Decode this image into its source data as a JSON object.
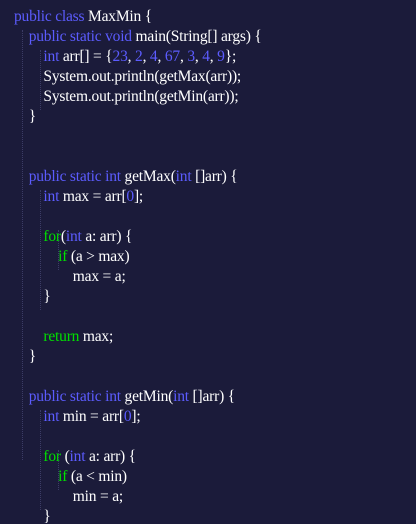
{
  "editor": {
    "theme": {
      "background": "#1b1b3a",
      "keyword_color": "#5c5cff",
      "control_keyword_color": "#00e000",
      "text_color": "#ffffff"
    },
    "lines": [
      [
        {
          "t": "kw",
          "v": "public class "
        },
        {
          "t": "tx",
          "v": "MaxMin {"
        }
      ],
      [
        {
          "t": "tx",
          "v": "    "
        },
        {
          "t": "kw",
          "v": "public static void "
        },
        {
          "t": "tx",
          "v": "main(String[] args) {"
        }
      ],
      [
        {
          "t": "tx",
          "v": "        "
        },
        {
          "t": "kw",
          "v": "int "
        },
        {
          "t": "tx",
          "v": "arr[] = {"
        },
        {
          "t": "num",
          "v": "23"
        },
        {
          "t": "tx",
          "v": ", "
        },
        {
          "t": "num",
          "v": "2"
        },
        {
          "t": "tx",
          "v": ", "
        },
        {
          "t": "num",
          "v": "4"
        },
        {
          "t": "tx",
          "v": ", "
        },
        {
          "t": "num",
          "v": "67"
        },
        {
          "t": "tx",
          "v": ", "
        },
        {
          "t": "num",
          "v": "3"
        },
        {
          "t": "tx",
          "v": ", "
        },
        {
          "t": "num",
          "v": "4"
        },
        {
          "t": "tx",
          "v": ", "
        },
        {
          "t": "num",
          "v": "9"
        },
        {
          "t": "tx",
          "v": "};"
        }
      ],
      [
        {
          "t": "tx",
          "v": "        System.out.println(getMax(arr));"
        }
      ],
      [
        {
          "t": "tx",
          "v": "        System.out.println(getMin(arr));"
        }
      ],
      [
        {
          "t": "tx",
          "v": "    }"
        }
      ],
      [],
      [],
      [
        {
          "t": "tx",
          "v": "    "
        },
        {
          "t": "kw",
          "v": "public static int "
        },
        {
          "t": "tx",
          "v": "getMax("
        },
        {
          "t": "kw",
          "v": "int "
        },
        {
          "t": "tx",
          "v": "[]arr) {"
        }
      ],
      [
        {
          "t": "tx",
          "v": "        "
        },
        {
          "t": "kw",
          "v": "int "
        },
        {
          "t": "tx",
          "v": "max = arr["
        },
        {
          "t": "num",
          "v": "0"
        },
        {
          "t": "tx",
          "v": "];"
        }
      ],
      [],
      [
        {
          "t": "tx",
          "v": "        "
        },
        {
          "t": "ctl",
          "v": "for"
        },
        {
          "t": "tx",
          "v": "("
        },
        {
          "t": "kw",
          "v": "int "
        },
        {
          "t": "tx",
          "v": "a: arr) {"
        }
      ],
      [
        {
          "t": "tx",
          "v": "            "
        },
        {
          "t": "ctl",
          "v": "if "
        },
        {
          "t": "tx",
          "v": "(a > max)"
        }
      ],
      [
        {
          "t": "tx",
          "v": "                max = a;"
        }
      ],
      [
        {
          "t": "tx",
          "v": "        }"
        }
      ],
      [],
      [
        {
          "t": "tx",
          "v": "        "
        },
        {
          "t": "ctl",
          "v": "return "
        },
        {
          "t": "tx",
          "v": "max;"
        }
      ],
      [
        {
          "t": "tx",
          "v": "    }"
        }
      ],
      [],
      [
        {
          "t": "tx",
          "v": "    "
        },
        {
          "t": "kw",
          "v": "public static int "
        },
        {
          "t": "tx",
          "v": "getMin("
        },
        {
          "t": "kw",
          "v": "int "
        },
        {
          "t": "tx",
          "v": "[]arr) {"
        }
      ],
      [
        {
          "t": "tx",
          "v": "        "
        },
        {
          "t": "kw",
          "v": "int "
        },
        {
          "t": "tx",
          "v": "min = arr["
        },
        {
          "t": "num",
          "v": "0"
        },
        {
          "t": "tx",
          "v": "];"
        }
      ],
      [],
      [
        {
          "t": "tx",
          "v": "        "
        },
        {
          "t": "ctl",
          "v": "for "
        },
        {
          "t": "tx",
          "v": "("
        },
        {
          "t": "kw",
          "v": "int "
        },
        {
          "t": "tx",
          "v": "a: arr) {"
        }
      ],
      [
        {
          "t": "tx",
          "v": "            "
        },
        {
          "t": "ctl",
          "v": "if "
        },
        {
          "t": "tx",
          "v": "(a < min)"
        }
      ],
      [
        {
          "t": "tx",
          "v": "                min = a;"
        }
      ],
      [
        {
          "t": "tx",
          "v": "        }"
        }
      ]
    ]
  }
}
